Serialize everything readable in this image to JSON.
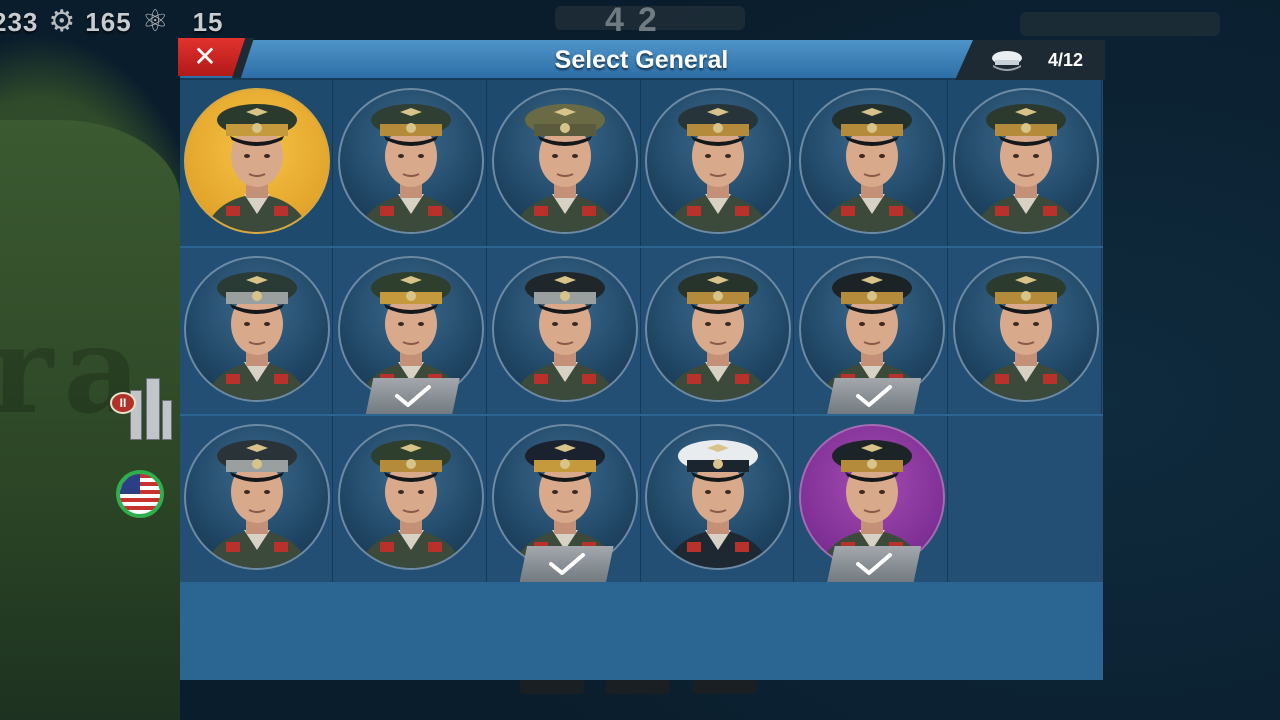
{
  "resources": [
    {
      "name": "money",
      "value": "233",
      "icon": "coin-icon"
    },
    {
      "name": "industry",
      "value": "165",
      "icon": "gear-icon"
    },
    {
      "name": "science",
      "value": "15",
      "icon": "atom-icon"
    }
  ],
  "center_counter": {
    "left": "4",
    "right": "2"
  },
  "dialog": {
    "title": "Select General",
    "close_label": "✕",
    "selected_count": "4/12",
    "count_icon": "officer-cap-icon"
  },
  "generals": [
    {
      "row": 0,
      "col": 0,
      "frame": "gold",
      "cap": "#2a3a2c",
      "band": "#c49a3c",
      "selected": false
    },
    {
      "row": 0,
      "col": 1,
      "frame": "blue",
      "cap": "#2f3f33",
      "band": "#b48b3a",
      "selected": false
    },
    {
      "row": 0,
      "col": 2,
      "frame": "blue",
      "cap": "#6a6b45",
      "band": "#5a5b3c",
      "selected": false
    },
    {
      "row": 0,
      "col": 3,
      "frame": "blue",
      "cap": "#27343a",
      "band": "#b48b3a",
      "selected": false
    },
    {
      "row": 0,
      "col": 4,
      "frame": "blue",
      "cap": "#23302c",
      "band": "#b48b3a",
      "selected": false
    },
    {
      "row": 0,
      "col": 5,
      "frame": "blue",
      "cap": "#2c3a2d",
      "band": "#b48b3a",
      "selected": false
    },
    {
      "row": 1,
      "col": 0,
      "frame": "blue",
      "cap": "#2a3a34",
      "band": "#9aa0a0",
      "selected": false
    },
    {
      "row": 1,
      "col": 1,
      "frame": "blue",
      "cap": "#2f3f2e",
      "band": "#c49a3c",
      "selected": true
    },
    {
      "row": 1,
      "col": 2,
      "frame": "blue",
      "cap": "#1f272b",
      "band": "#9aa0a0",
      "selected": false
    },
    {
      "row": 1,
      "col": 3,
      "frame": "blue",
      "cap": "#27342c",
      "band": "#b48b3a",
      "selected": false
    },
    {
      "row": 1,
      "col": 4,
      "frame": "blue",
      "cap": "#1c2326",
      "band": "#b48b3a",
      "selected": true
    },
    {
      "row": 1,
      "col": 5,
      "frame": "blue",
      "cap": "#2b3c2f",
      "band": "#b48b3a",
      "selected": false
    },
    {
      "row": 2,
      "col": 0,
      "frame": "blue",
      "cap": "#2a3438",
      "band": "#9aa0a0",
      "selected": false
    },
    {
      "row": 2,
      "col": 1,
      "frame": "blue",
      "cap": "#2f3f2e",
      "band": "#b48b3a",
      "selected": false
    },
    {
      "row": 2,
      "col": 2,
      "frame": "blue",
      "cap": "#1a2230",
      "band": "#c49a3c",
      "selected": true
    },
    {
      "row": 2,
      "col": 3,
      "frame": "blue",
      "cap": "#e8ecef",
      "band": "#1b2530",
      "selected": false
    },
    {
      "row": 2,
      "col": 4,
      "frame": "purple",
      "cap": "#1d2428",
      "band": "#b48b3a",
      "selected": true
    }
  ],
  "colors": {
    "header": "#3d84bd",
    "close": "#d4282a",
    "body": "#2b6693",
    "row": "#224f73"
  }
}
